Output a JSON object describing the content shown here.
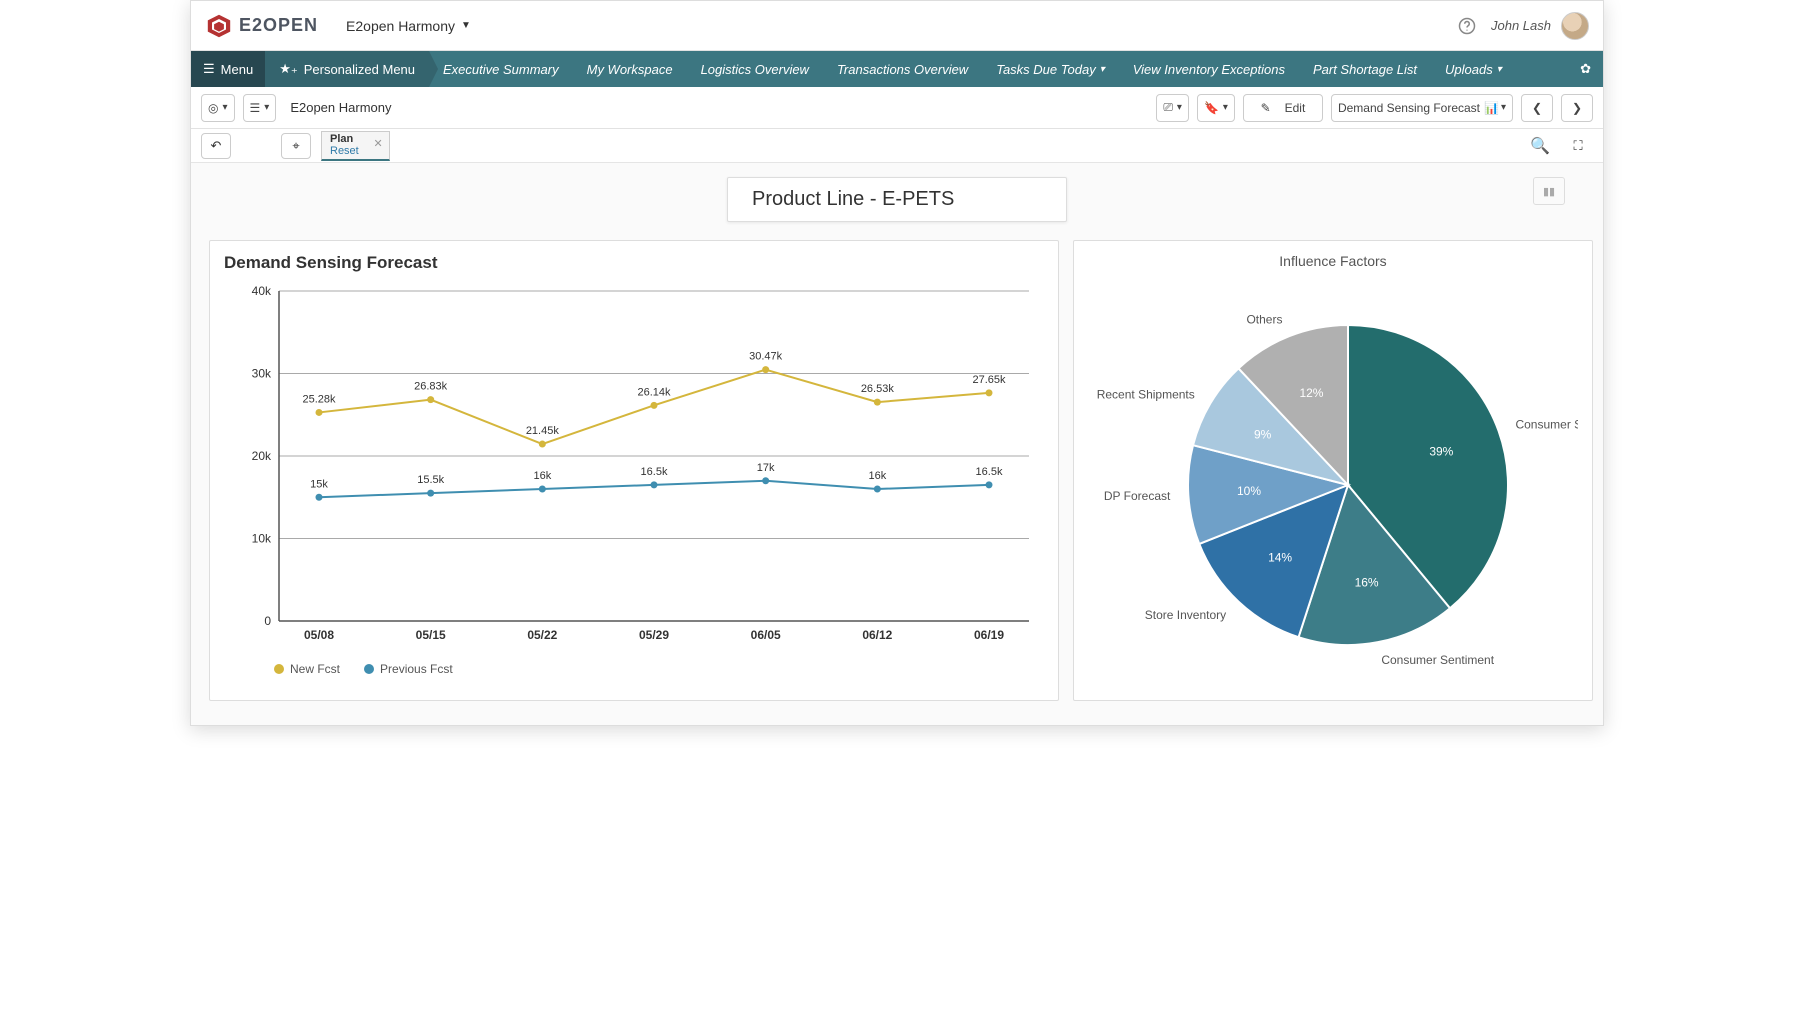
{
  "topbar": {
    "brand": "E2OPEN",
    "app_title": "E2open Harmony",
    "user_name": "John Lash"
  },
  "navbar": {
    "menu_label": "Menu",
    "personalized_label": "Personalized Menu",
    "items": [
      {
        "label": "Executive Summary"
      },
      {
        "label": "My Workspace"
      },
      {
        "label": "Logistics Overview"
      },
      {
        "label": "Transactions Overview"
      },
      {
        "label": "Tasks Due Today",
        "has_caret": true
      },
      {
        "label": "View Inventory Exceptions"
      },
      {
        "label": "Part Shortage List"
      },
      {
        "label": "Uploads",
        "has_caret": true
      }
    ]
  },
  "toolbar": {
    "context_label": "E2open Harmony",
    "edit_label": "Edit",
    "view_name": "Demand Sensing Forecast"
  },
  "planstrip": {
    "tab_title": "Plan",
    "tab_sub": "Reset"
  },
  "header_card": "Product Line - E-PETS",
  "line_panel_title": "Demand Sensing Forecast",
  "pie_panel_title": "Influence Factors",
  "chart_data": [
    {
      "type": "line",
      "title": "Demand Sensing Forecast",
      "categories": [
        "05/08",
        "05/15",
        "05/22",
        "05/29",
        "06/05",
        "06/12",
        "06/19"
      ],
      "ylim": [
        0,
        40000
      ],
      "yticks": [
        0,
        10000,
        20000,
        30000,
        40000
      ],
      "ytick_labels": [
        "0",
        "10k",
        "20k",
        "30k",
        "40k"
      ],
      "series": [
        {
          "name": "New Fcst",
          "color": "#d4b63c",
          "values": [
            25280,
            26830,
            21450,
            26140,
            30470,
            26530,
            27650
          ],
          "labels": [
            "25.28k",
            "26.83k",
            "21.45k",
            "26.14k",
            "30.47k",
            "26.53k",
            "27.65k"
          ]
        },
        {
          "name": "Previous Fcst",
          "color": "#3f8eb0",
          "values": [
            15000,
            15500,
            16000,
            16500,
            17000,
            16000,
            16500
          ],
          "labels": [
            "15k",
            "15.5k",
            "16k",
            "16.5k",
            "17k",
            "16k",
            "16.5k"
          ]
        }
      ]
    },
    {
      "type": "pie",
      "title": "Influence Factors",
      "slices": [
        {
          "name": "Consumer Sa...",
          "pct": 39,
          "color": "#236d6d"
        },
        {
          "name": "Consumer Sentiment",
          "pct": 16,
          "color": "#3d7d88"
        },
        {
          "name": "Store Inventory",
          "pct": 14,
          "color": "#2f71a6"
        },
        {
          "name": "DP Forecast",
          "pct": 10,
          "color": "#6fa0c8"
        },
        {
          "name": "Recent Shipments",
          "pct": 9,
          "color": "#a9c8de"
        },
        {
          "name": "Others",
          "pct": 12,
          "color": "#b0b0b0"
        }
      ]
    }
  ]
}
